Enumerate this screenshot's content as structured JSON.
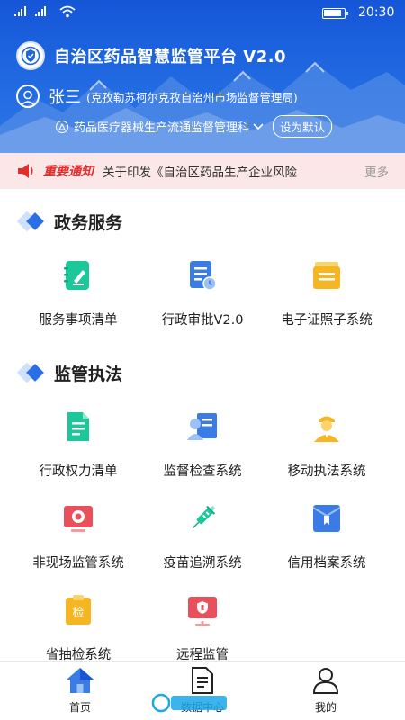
{
  "status_bar": {
    "time": "20:30"
  },
  "header": {
    "app_title": "自治区药品智慧监管平台 V2.0",
    "user_name": "张三",
    "user_org": "(克孜勒苏柯尔克孜自治州市场监督管理局)",
    "department": "药品医疗器械生产流通监督管理科",
    "set_default_label": "设为默认"
  },
  "notice": {
    "tag": "重要通知",
    "text": "关于印发《自治区药品生产企业风险",
    "more_label": "更多"
  },
  "sections": {
    "gov_services": {
      "title": "政务服务",
      "items": [
        {
          "label": "服务事项清单",
          "icon": "checklist-icon"
        },
        {
          "label": "行政审批V2.0",
          "icon": "approval-document-icon"
        },
        {
          "label": "电子证照子系统",
          "icon": "license-folder-icon"
        }
      ]
    },
    "supervision": {
      "title": "监管执法",
      "items": [
        {
          "label": "行政权力清单",
          "icon": "power-list-icon"
        },
        {
          "label": "监督检查系统",
          "icon": "inspector-icon"
        },
        {
          "label": "移动执法系统",
          "icon": "officer-icon"
        },
        {
          "label": "非现场监管系统",
          "icon": "remote-monitor-icon"
        },
        {
          "label": "疫苗追溯系统",
          "icon": "syringe-icon"
        },
        {
          "label": "信用档案系统",
          "icon": "credit-archive-icon"
        },
        {
          "label": "省抽检系统",
          "icon": "sampling-inspection-icon"
        },
        {
          "label": "远程监管",
          "icon": "remote-supervision-icon"
        }
      ]
    }
  },
  "bottom_nav": {
    "home": "首页",
    "data": "数据中心",
    "mine": "我的"
  },
  "colors": {
    "primary": "#1f67e0",
    "notice_bg": "#fbe7e8",
    "notice_red": "#e32c2c",
    "green": "#1cc79a",
    "orange": "#f6b523",
    "red": "#e8505b",
    "blue": "#3a7be6"
  }
}
